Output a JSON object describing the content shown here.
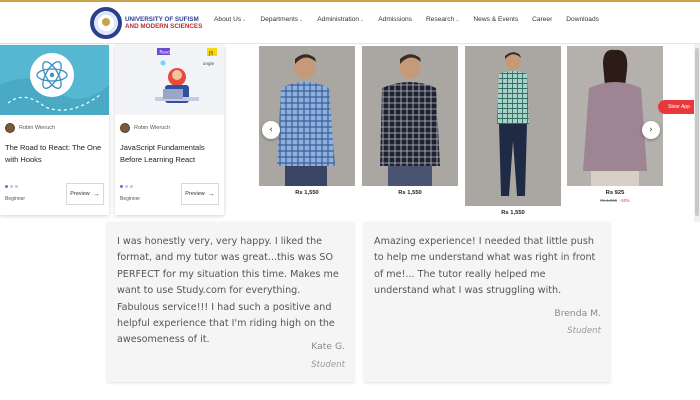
{
  "header": {
    "logo_line1": "UNIVERSITY OF SUFISM",
    "logo_line2": "AND MODERN SCIENCES",
    "nav": [
      {
        "label": "About Us",
        "dropdown": true
      },
      {
        "label": "Departments",
        "dropdown": true
      },
      {
        "label": "Administration",
        "dropdown": true
      },
      {
        "label": "Admissions",
        "dropdown": false
      },
      {
        "label": "Research",
        "dropdown": true
      },
      {
        "label": "News & Events",
        "dropdown": false
      },
      {
        "label": "Career",
        "dropdown": false
      },
      {
        "label": "Downloads",
        "dropdown": false
      }
    ],
    "colors": {
      "brand_blue": "#2b3f8f",
      "brand_red": "#c2272d",
      "gold": "#c9a24a"
    }
  },
  "courses": [
    {
      "author": "Robin Wieruch",
      "title": "The Road to React: The One with Hooks",
      "level": "Beginner",
      "button": "Preview",
      "arrow_icon": "arrow-right-icon"
    },
    {
      "author": "Robin Wieruch",
      "title": "JavaScript Fundamentals Before Learning React",
      "level": "Beginner",
      "button": "Preview",
      "arrow_icon": "arrow-right-icon",
      "badges": [
        "React",
        "JS"
      ]
    }
  ],
  "products": [
    {
      "price": "Rs 1,550",
      "shirt_color": "#5a7fb5",
      "pattern": "light-blue-check"
    },
    {
      "price": "Rs 1,550",
      "shirt_color": "#2a2e3a",
      "pattern": "dark-check"
    },
    {
      "price": "Rs 1,550",
      "shirt_color": "#7fb0a8",
      "pattern": "teal-check"
    },
    {
      "price": "Rs 925",
      "shirt_color": "#a08a96",
      "pattern": "mauve-plain",
      "original_price": "Rs 1,850",
      "discount": "-50%"
    }
  ],
  "carousel": {
    "prev_icon": "chevron-left-icon",
    "next_icon": "chevron-right-icon",
    "steer_label": "Steer App"
  },
  "testimonials": [
    {
      "quote": "I was honestly very, very happy. I liked the format, and my tutor was great...this was SO PERFECT for my situation this time. Makes me want to use Study.com for everything. Fabulous service!!! I had such a positive and helpful experience that I'm riding high on the awesomeness of it.",
      "name": "Kate G.",
      "role": "Student"
    },
    {
      "quote": "Amazing experience! I needed that little push to help me understand what was right in front of me!... The tutor really helped me understand what I was struggling with.",
      "name": "Brenda M.",
      "role": "Student"
    }
  ]
}
